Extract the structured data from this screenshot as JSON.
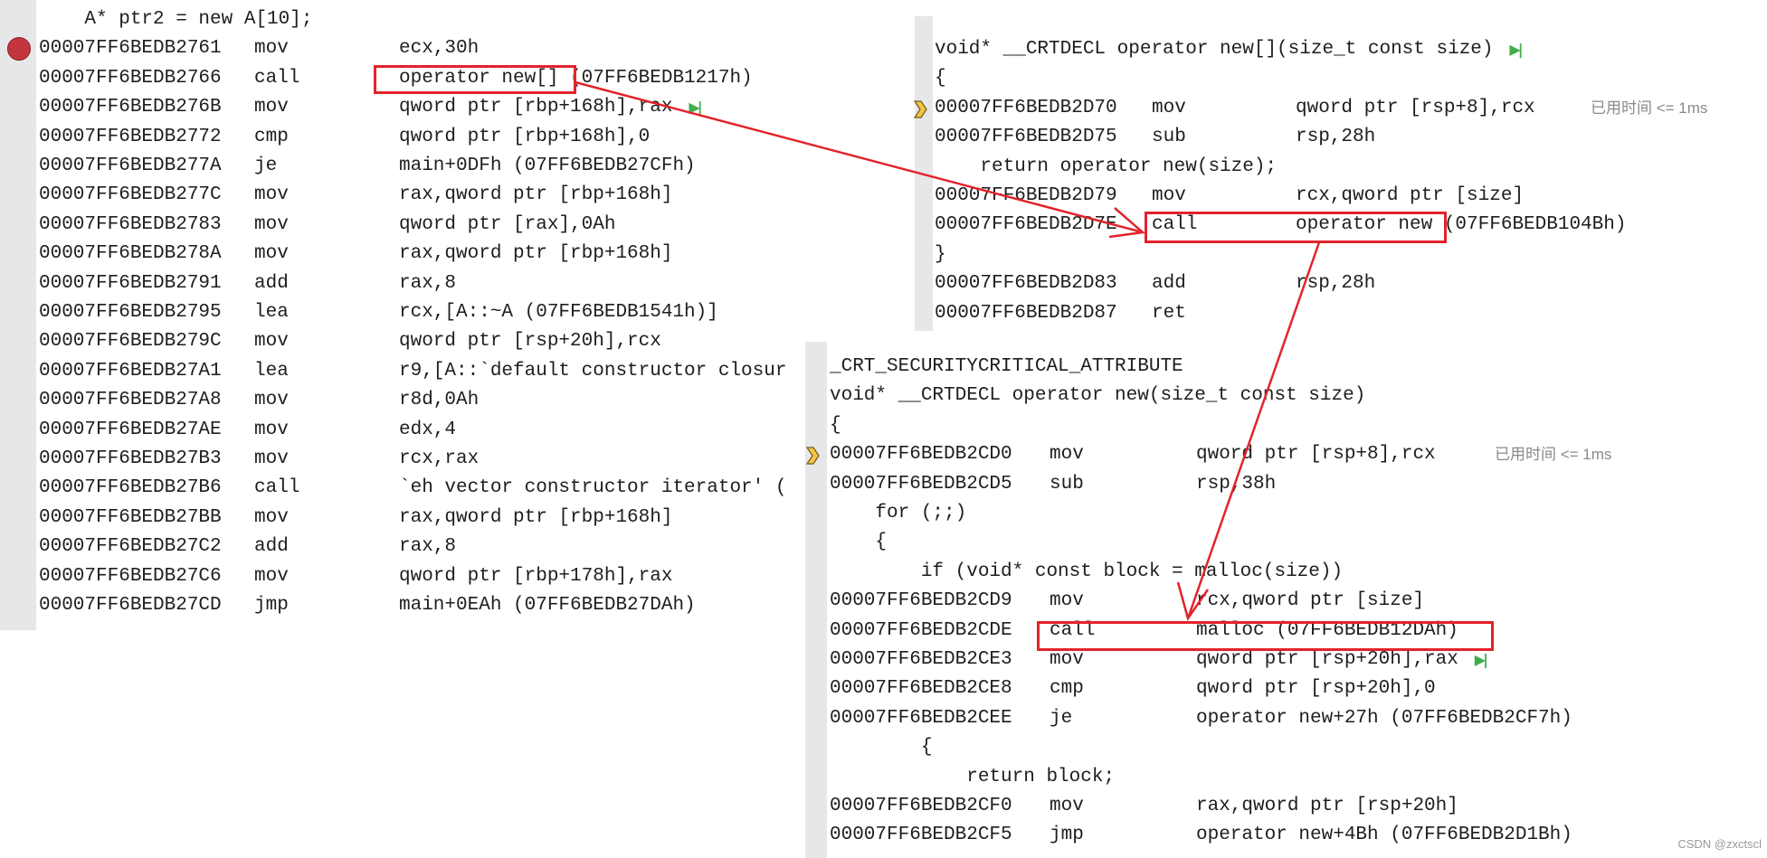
{
  "left_panel": {
    "rows": [
      {
        "src": "    A* ptr2 = new A[10];"
      },
      {
        "addr": "00007FF6BEDB2761",
        "op": "mov",
        "args": "ecx,30h",
        "marker": "breakpoint"
      },
      {
        "addr": "00007FF6BEDB2766",
        "op": "call",
        "args": "operator new[] (07FF6BEDB1217h)"
      },
      {
        "addr": "00007FF6BEDB276B",
        "op": "mov",
        "args": "qword ptr [rbp+168h],rax",
        "marker": "step"
      },
      {
        "addr": "00007FF6BEDB2772",
        "op": "cmp",
        "args": "qword ptr [rbp+168h],0"
      },
      {
        "addr": "00007FF6BEDB277A",
        "op": "je",
        "args": "main+0DFh (07FF6BEDB27CFh)"
      },
      {
        "addr": "00007FF6BEDB277C",
        "op": "mov",
        "args": "rax,qword ptr [rbp+168h]"
      },
      {
        "addr": "00007FF6BEDB2783",
        "op": "mov",
        "args": "qword ptr [rax],0Ah"
      },
      {
        "addr": "00007FF6BEDB278A",
        "op": "mov",
        "args": "rax,qword ptr [rbp+168h]"
      },
      {
        "addr": "00007FF6BEDB2791",
        "op": "add",
        "args": "rax,8"
      },
      {
        "addr": "00007FF6BEDB2795",
        "op": "lea",
        "args": "rcx,[A::~A (07FF6BEDB1541h)]"
      },
      {
        "addr": "00007FF6BEDB279C",
        "op": "mov",
        "args": "qword ptr [rsp+20h],rcx"
      },
      {
        "addr": "00007FF6BEDB27A1",
        "op": "lea",
        "args": "r9,[A::`default constructor closur"
      },
      {
        "addr": "00007FF6BEDB27A8",
        "op": "mov",
        "args": "r8d,0Ah"
      },
      {
        "addr": "00007FF6BEDB27AE",
        "op": "mov",
        "args": "edx,4"
      },
      {
        "addr": "00007FF6BEDB27B3",
        "op": "mov",
        "args": "rcx,rax"
      },
      {
        "addr": "00007FF6BEDB27B6",
        "op": "call",
        "args": "`eh vector constructor iterator' ("
      },
      {
        "addr": "00007FF6BEDB27BB",
        "op": "mov",
        "args": "rax,qword ptr [rbp+168h]"
      },
      {
        "addr": "00007FF6BEDB27C2",
        "op": "add",
        "args": "rax,8"
      },
      {
        "addr": "00007FF6BEDB27C6",
        "op": "mov",
        "args": "qword ptr [rbp+178h],rax"
      },
      {
        "addr": "00007FF6BEDB27CD",
        "op": "jmp",
        "args": "main+0EAh (07FF6BEDB27DAh)"
      }
    ]
  },
  "top_right_panel": {
    "rows": [
      {
        "src": "void* __CRTDECL operator new[](size_t const size)",
        "marker": "step"
      },
      {
        "src": "{"
      },
      {
        "addr": "00007FF6BEDB2D70",
        "op": "mov",
        "args": "qword ptr [rsp+8],rcx",
        "marker": "current",
        "timing": "已用时间 <= 1ms"
      },
      {
        "addr": "00007FF6BEDB2D75",
        "op": "sub",
        "args": "rsp,28h"
      },
      {
        "src": "    return operator new(size);"
      },
      {
        "addr": "00007FF6BEDB2D79",
        "op": "mov",
        "args": "rcx,qword ptr [size]"
      },
      {
        "addr": "00007FF6BEDB2D7E",
        "op": "call",
        "args": "operator new (07FF6BEDB104Bh)"
      },
      {
        "src": "}"
      },
      {
        "addr": "00007FF6BEDB2D83",
        "op": "add",
        "args": "rsp,28h"
      },
      {
        "addr": "00007FF6BEDB2D87",
        "op": "ret",
        "args": ""
      }
    ]
  },
  "bottom_panel": {
    "rows": [
      {
        "src": "_CRT_SECURITYCRITICAL_ATTRIBUTE"
      },
      {
        "src": "void* __CRTDECL operator new(size_t const size)"
      },
      {
        "src": "{"
      },
      {
        "addr": "00007FF6BEDB2CD0",
        "op": "mov",
        "args": "qword ptr [rsp+8],rcx",
        "marker": "current",
        "timing": "已用时间 <= 1ms"
      },
      {
        "addr": "00007FF6BEDB2CD5",
        "op": "sub",
        "args": "rsp,38h"
      },
      {
        "src": "    for (;;)"
      },
      {
        "src": "    {"
      },
      {
        "src": "        if (void* const block = malloc(size))"
      },
      {
        "addr": "00007FF6BEDB2CD9",
        "op": "mov",
        "args": "rcx,qword ptr [size]"
      },
      {
        "addr": "00007FF6BEDB2CDE",
        "op": "call",
        "args": "malloc (07FF6BEDB12DAh)"
      },
      {
        "addr": "00007FF6BEDB2CE3",
        "op": "mov",
        "args": "qword ptr [rsp+20h],rax",
        "marker": "step"
      },
      {
        "addr": "00007FF6BEDB2CE8",
        "op": "cmp",
        "args": "qword ptr [rsp+20h],0"
      },
      {
        "addr": "00007FF6BEDB2CEE",
        "op": "je",
        "args": "operator new+27h (07FF6BEDB2CF7h)"
      },
      {
        "src": "        {"
      },
      {
        "src": "            return block;"
      },
      {
        "addr": "00007FF6BEDB2CF0",
        "op": "mov",
        "args": "rax,qword ptr [rsp+20h]"
      },
      {
        "addr": "00007FF6BEDB2CF5",
        "op": "jmp",
        "args": "operator new+4Bh (07FF6BEDB2D1Bh)"
      }
    ]
  },
  "icons": {
    "breakpoint": "breakpoint-icon",
    "current": "instruction-pointer-icon",
    "step": "run-to-here-icon"
  },
  "colors": {
    "annotation_red": "#e2232b",
    "breakpoint": "#c4363f",
    "step_green": "#3fae4b",
    "ip_yellow": "#f5c542"
  },
  "watermark": "CSDN @zxctscl"
}
